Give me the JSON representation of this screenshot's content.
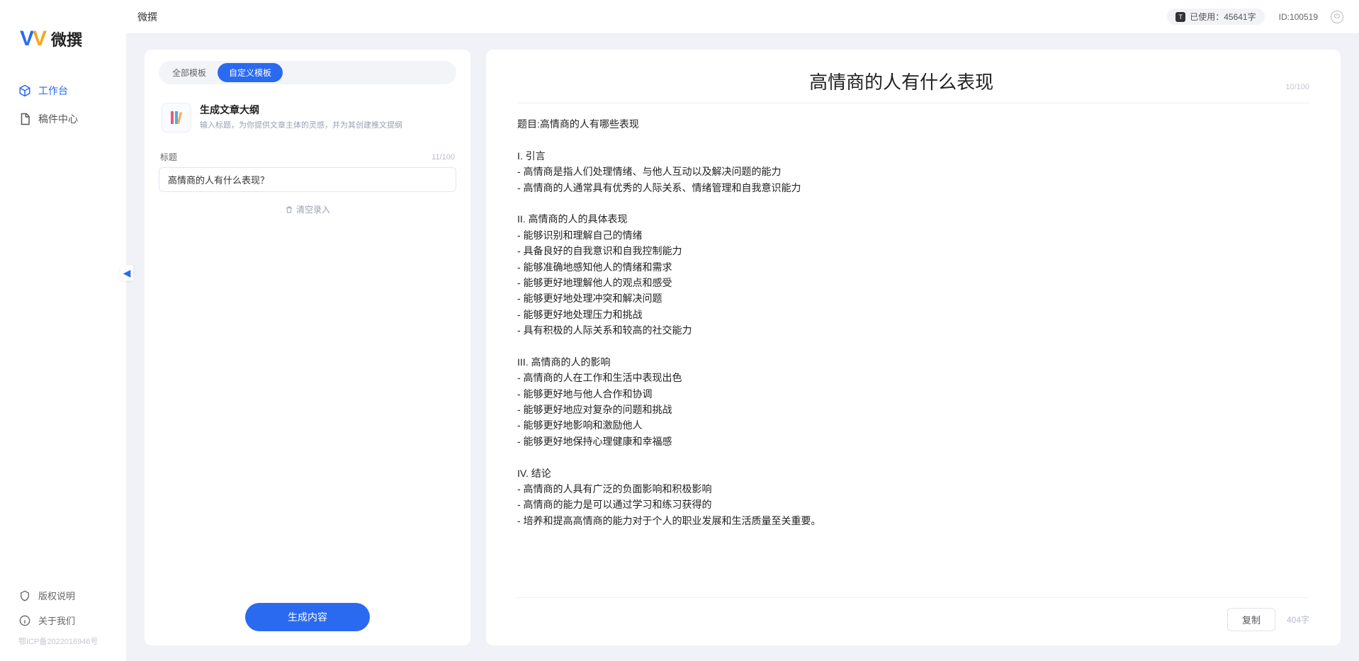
{
  "brand": {
    "name": "微撰"
  },
  "sidebar": {
    "items": [
      {
        "label": "工作台",
        "icon": "cube-icon",
        "active": true
      },
      {
        "label": "稿件中心",
        "icon": "doc-icon",
        "active": false
      }
    ],
    "bottom": [
      {
        "label": "版权说明",
        "icon": "shield-icon"
      },
      {
        "label": "关于我们",
        "icon": "info-icon"
      }
    ],
    "icp": "鄂ICP备2022016946号"
  },
  "topbar": {
    "title": "微撰",
    "usage_label": "已使用：45641字",
    "id_label": "ID:100519"
  },
  "tabs": {
    "all": "全部模板",
    "custom": "自定义模板"
  },
  "template": {
    "title": "生成文章大纲",
    "desc": "输入标题，为你提供文章主体的灵感，并为其创建推文提纲"
  },
  "field": {
    "label": "标题",
    "value": "高情商的人有什么表现？",
    "count": "11/100"
  },
  "clear_label": "清空录入",
  "generate_label": "生成内容",
  "result": {
    "title": "高情商的人有什么表现",
    "title_count": "10/100",
    "body": "题目:高情商的人有哪些表现\n\nI. 引言\n- 高情商是指人们处理情绪、与他人互动以及解决问题的能力\n- 高情商的人通常具有优秀的人际关系、情绪管理和自我意识能力\n\nII. 高情商的人的具体表现\n- 能够识别和理解自己的情绪\n- 具备良好的自我意识和自我控制能力\n- 能够准确地感知他人的情绪和需求\n- 能够更好地理解他人的观点和感受\n- 能够更好地处理冲突和解决问题\n- 能够更好地处理压力和挑战\n- 具有积极的人际关系和较高的社交能力\n\nIII. 高情商的人的影响\n- 高情商的人在工作和生活中表现出色\n- 能够更好地与他人合作和协调\n- 能够更好地应对复杂的问题和挑战\n- 能够更好地影响和激励他人\n- 能够更好地保持心理健康和幸福感\n\nIV. 结论\n- 高情商的人具有广泛的负面影响和积极影响\n- 高情商的能力是可以通过学习和练习获得的\n- 培养和提高高情商的能力对于个人的职业发展和生活质量至关重要。",
    "copy_label": "复制",
    "word_count": "404字"
  }
}
